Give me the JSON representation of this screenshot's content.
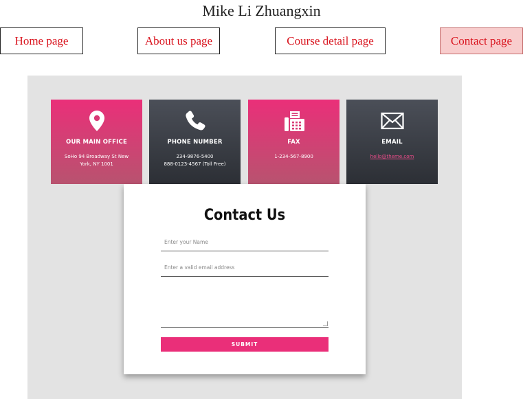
{
  "site": {
    "title": "Mike Li Zhuangxin"
  },
  "nav": {
    "items": [
      {
        "label": "Home page"
      },
      {
        "label": "About us page"
      },
      {
        "label": "Course detail page"
      },
      {
        "label": "Contact page",
        "active": true
      }
    ]
  },
  "cards": [
    {
      "icon": "map-pin-icon",
      "title": "OUR MAIN OFFICE",
      "lines": [
        "SoHo 94 Broadway St New",
        "York, NY 1001"
      ],
      "color": "#ea2f79"
    },
    {
      "icon": "phone-icon",
      "title": "PHONE NUMBER",
      "lines": [
        "234-9876-5400",
        "888-0123-4567 (Toll Free)"
      ],
      "color": "#3b3e45"
    },
    {
      "icon": "fax-icon",
      "title": "FAX",
      "lines": [
        "1-234-567-8900"
      ],
      "color": "#ea2f79"
    },
    {
      "icon": "envelope-icon",
      "title": "EMAIL",
      "lines": [
        "hello@theme.com"
      ],
      "color": "#3b3e45"
    }
  ],
  "form": {
    "title": "Contact Us",
    "name_placeholder": "Enter your Name",
    "email_placeholder": "Enter a valid email address",
    "message_placeholder": "",
    "submit_label": "SUBMIT"
  },
  "colors": {
    "accent": "#ea2f79",
    "dark": "#3b3e45",
    "nav_text": "#d9141e",
    "nav_active_bg": "#f8cdcd",
    "panel_bg": "#e3e3e3"
  }
}
